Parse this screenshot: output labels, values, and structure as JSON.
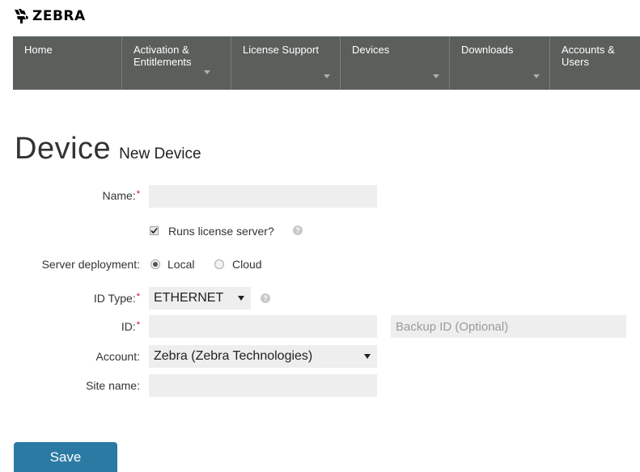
{
  "brand": {
    "name": "ZEBRA"
  },
  "nav": {
    "items": [
      {
        "line1": "Home",
        "line2": ""
      },
      {
        "line1": "Activation &",
        "line2": "Entitlements"
      },
      {
        "line1": "License Support",
        "line2": ""
      },
      {
        "line1": "Devices",
        "line2": ""
      },
      {
        "line1": "Downloads",
        "line2": ""
      },
      {
        "line1": "Accounts &",
        "line2": "Users"
      }
    ]
  },
  "page": {
    "title": "Device",
    "subtitle": "New Device"
  },
  "form": {
    "name_label": "Name:",
    "name_value": "",
    "required_mark": "*",
    "runs_license_server_label": "Runs license server?",
    "runs_license_server_checked": true,
    "server_deployment_label": "Server deployment:",
    "deployment_local": "Local",
    "deployment_cloud": "Cloud",
    "deployment_selected": "Local",
    "id_type_label": "ID Type:",
    "id_type_value": "ETHERNET",
    "id_label": "ID:",
    "id_value": "",
    "backup_id_placeholder": "Backup ID (Optional)",
    "account_label": "Account:",
    "account_value": "Zebra (Zebra Technologies)",
    "site_name_label": "Site name:",
    "site_name_value": ""
  },
  "actions": {
    "save_label": "Save"
  },
  "colors": {
    "nav_bg": "#5a5f5b",
    "save_bg": "#2a7aa3",
    "required": "#d0021b",
    "field_bg": "#eeeeee"
  },
  "icons": {
    "logo": "zebra-head-logo",
    "help": "question-circle-icon",
    "dropdown": "caret-down-icon"
  }
}
